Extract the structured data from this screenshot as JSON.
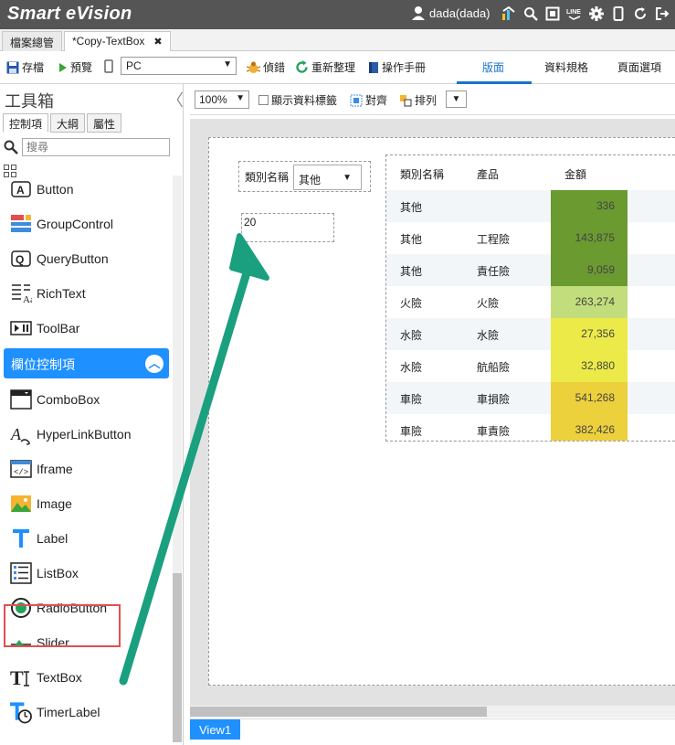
{
  "app": {
    "brand": "Smart eVision",
    "user": "dada(dada)"
  },
  "title_icons": [
    "user-icon",
    "chart-icon",
    "search-icon",
    "fullscreen-icon",
    "line-icon",
    "gear-icon",
    "mobile-icon",
    "refresh-icon",
    "logout-icon"
  ],
  "doc_tabs": [
    {
      "label": "檔案總管",
      "active": false
    },
    {
      "label": "*Copy-TextBox",
      "active": true,
      "close": "✖"
    }
  ],
  "toolbar": {
    "save": "存檔",
    "preview": "預覽",
    "device": "PC",
    "debug": "偵錯",
    "reload": "重新整理",
    "manual": "操作手冊",
    "panel_tabs": [
      "版面",
      "資料規格",
      "頁面選項"
    ],
    "active_panel_tab": "版面"
  },
  "toolbox": {
    "title": "工具箱",
    "collapse": "〈",
    "tabs": [
      "控制項",
      "大綱",
      "屬性"
    ],
    "search_placeholder": "搜尋",
    "items_top": [
      "Button",
      "GroupControl",
      "QueryButton",
      "RichText",
      "ToolBar"
    ],
    "section": "欄位控制項",
    "section_chevron": "︿",
    "items_fields": [
      "ComboBox",
      "HyperLinkButton",
      "Iframe",
      "Image",
      "Label",
      "ListBox",
      "RadioButton",
      "Slider",
      "TextBox",
      "TimerLabel"
    ]
  },
  "canvas_toolbar": {
    "zoom": "100%",
    "show_labels": "顯示資料標籤",
    "align": "對齊",
    "arrange": "排列"
  },
  "canvas": {
    "combo_label": "類別名稱",
    "combo_value": "其他",
    "textbox_value": "20",
    "view_tab": "View1"
  },
  "table": {
    "headers": [
      "類別名稱",
      "產品",
      "金額"
    ],
    "rows": [
      {
        "category": "其他",
        "product": "",
        "amount": "336",
        "color": "#6a9a30"
      },
      {
        "category": "其他",
        "product": "工程險",
        "amount": "143,875",
        "color": "#6a9a30"
      },
      {
        "category": "其他",
        "product": "責任險",
        "amount": "9,059",
        "color": "#6a9a30"
      },
      {
        "category": "火險",
        "product": "火險",
        "amount": "263,274",
        "color": "#c2de7c"
      },
      {
        "category": "水險",
        "product": "水險",
        "amount": "27,356",
        "color": "#ecea48"
      },
      {
        "category": "水險",
        "product": "航船險",
        "amount": "32,880",
        "color": "#ecea48"
      },
      {
        "category": "車險",
        "product": "車損險",
        "amount": "541,268",
        "color": "#ecd03c"
      },
      {
        "category": "車險",
        "product": "車責險",
        "amount": "382,426",
        "color": "#ecd03c"
      }
    ]
  },
  "colors": {
    "titlebar": "#555555",
    "accent": "#1e90ff",
    "arrow": "#1aa07f",
    "highlight": "#e05050"
  }
}
